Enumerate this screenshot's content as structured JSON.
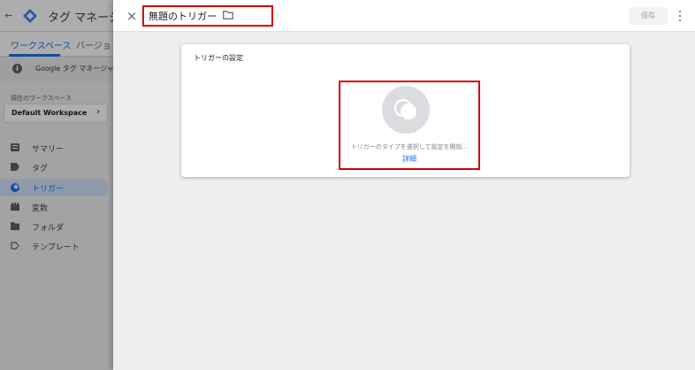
{
  "background_app": {
    "title": "タグ マネージ",
    "tabs": [
      {
        "label": "ワークスペース",
        "active": true
      },
      {
        "label": "バージョン",
        "active": false
      }
    ],
    "notice": "Google タグ マネージャーの",
    "workspace_label": "現在のワークスペース",
    "workspace_name": "Default Workspace",
    "nav_items": [
      {
        "label": "サマリー",
        "icon": "summary-icon"
      },
      {
        "label": "タグ",
        "icon": "tag-icon"
      },
      {
        "label": "トリガー",
        "icon": "trigger-icon",
        "active": true
      },
      {
        "label": "変数",
        "icon": "variables-icon"
      },
      {
        "label": "フォルダ",
        "icon": "folder-icon"
      },
      {
        "label": "テンプレート",
        "icon": "template-icon"
      }
    ]
  },
  "panel": {
    "close_icon": "×",
    "trigger_name": "無題のトリガー",
    "save_label": "保存",
    "config_card": {
      "title": "トリガーの設定",
      "hint": "トリガーのタイプを選択して設定を開始...",
      "learn_more": "詳細"
    }
  },
  "colors": {
    "accent": "#1a73e8",
    "highlight_box": "#d50000",
    "active_nav_bg": "#d2e3fc",
    "placeholder_icon_bg": "#dadce0"
  }
}
